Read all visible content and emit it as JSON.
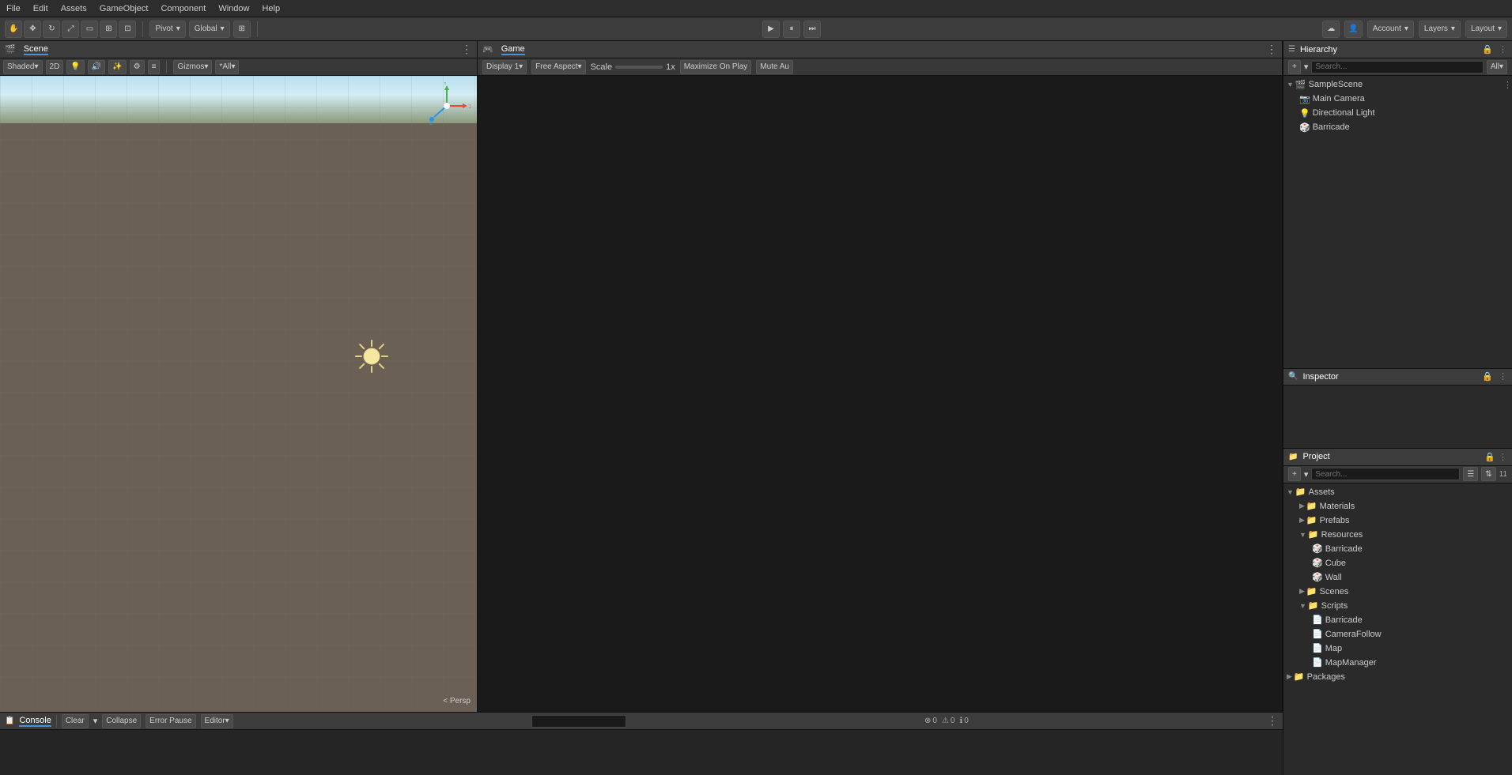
{
  "menubar": {
    "items": [
      "File",
      "Edit",
      "Assets",
      "GameObject",
      "Component",
      "Window",
      "Help"
    ]
  },
  "toolbar": {
    "pivot_label": "Pivot",
    "global_label": "Global",
    "play_icon": "▶",
    "pause_icon": "⏸",
    "step_icon": "⏭",
    "account_label": "Account",
    "layers_label": "Layers",
    "layout_label": "Layout"
  },
  "scene": {
    "tab_label": "Scene",
    "shading_mode": "Shaded",
    "view_2d": "2D",
    "gizmos_label": "Gizmos",
    "all_label": "All",
    "persp_label": "< Persp"
  },
  "game": {
    "tab_label": "Game",
    "display_label": "Display 1",
    "aspect_label": "Free Aspect",
    "scale_label": "Scale",
    "scale_value": "1x",
    "maximize_label": "Maximize On Play",
    "mute_label": "Mute Au"
  },
  "hierarchy": {
    "tab_label": "Hierarchy",
    "all_label": "All",
    "scene_name": "SampleScene",
    "items": [
      {
        "name": "Main Camera",
        "icon": "📷",
        "indent": 1
      },
      {
        "name": "Directional Light",
        "icon": "💡",
        "indent": 1
      },
      {
        "name": "Barricade",
        "icon": "🎲",
        "indent": 1
      }
    ]
  },
  "inspector": {
    "tab_label": "Inspector"
  },
  "project": {
    "tab_label": "Project",
    "search_placeholder": "Search...",
    "folders": [
      {
        "name": "Assets",
        "indent": 0,
        "expanded": true,
        "children": [
          {
            "name": "Materials",
            "indent": 1,
            "type": "folder",
            "expanded": false
          },
          {
            "name": "Prefabs",
            "indent": 1,
            "type": "folder",
            "expanded": false
          },
          {
            "name": "Resources",
            "indent": 1,
            "type": "folder",
            "expanded": true,
            "children": [
              {
                "name": "Barricade",
                "indent": 2,
                "type": "prefab"
              },
              {
                "name": "Cube",
                "indent": 2,
                "type": "prefab"
              },
              {
                "name": "Wall",
                "indent": 2,
                "type": "prefab"
              }
            ]
          },
          {
            "name": "Scenes",
            "indent": 1,
            "type": "folder",
            "expanded": false
          },
          {
            "name": "Scripts",
            "indent": 1,
            "type": "folder",
            "expanded": true,
            "children": [
              {
                "name": "Barricade",
                "indent": 2,
                "type": "script"
              },
              {
                "name": "CameraFollow",
                "indent": 2,
                "type": "script"
              },
              {
                "name": "Map",
                "indent": 2,
                "type": "script"
              },
              {
                "name": "MapManager",
                "indent": 2,
                "type": "script"
              }
            ]
          }
        ]
      },
      {
        "name": "Packages",
        "indent": 0,
        "type": "folder",
        "expanded": false
      }
    ]
  },
  "console": {
    "tab_label": "Console",
    "clear_label": "Clear",
    "collapse_label": "Collapse",
    "error_pause_label": "Error Pause",
    "editor_label": "Editor",
    "errors": 0,
    "warnings": 0,
    "messages": 0
  },
  "colors": {
    "accent": "#4a90d9",
    "background": "#2a2a2a",
    "panel": "#3c3c3c",
    "border": "#111",
    "sky_top": "#b8e0f0",
    "sky_bottom": "#8a9a7a",
    "grid": "#6b6055"
  }
}
